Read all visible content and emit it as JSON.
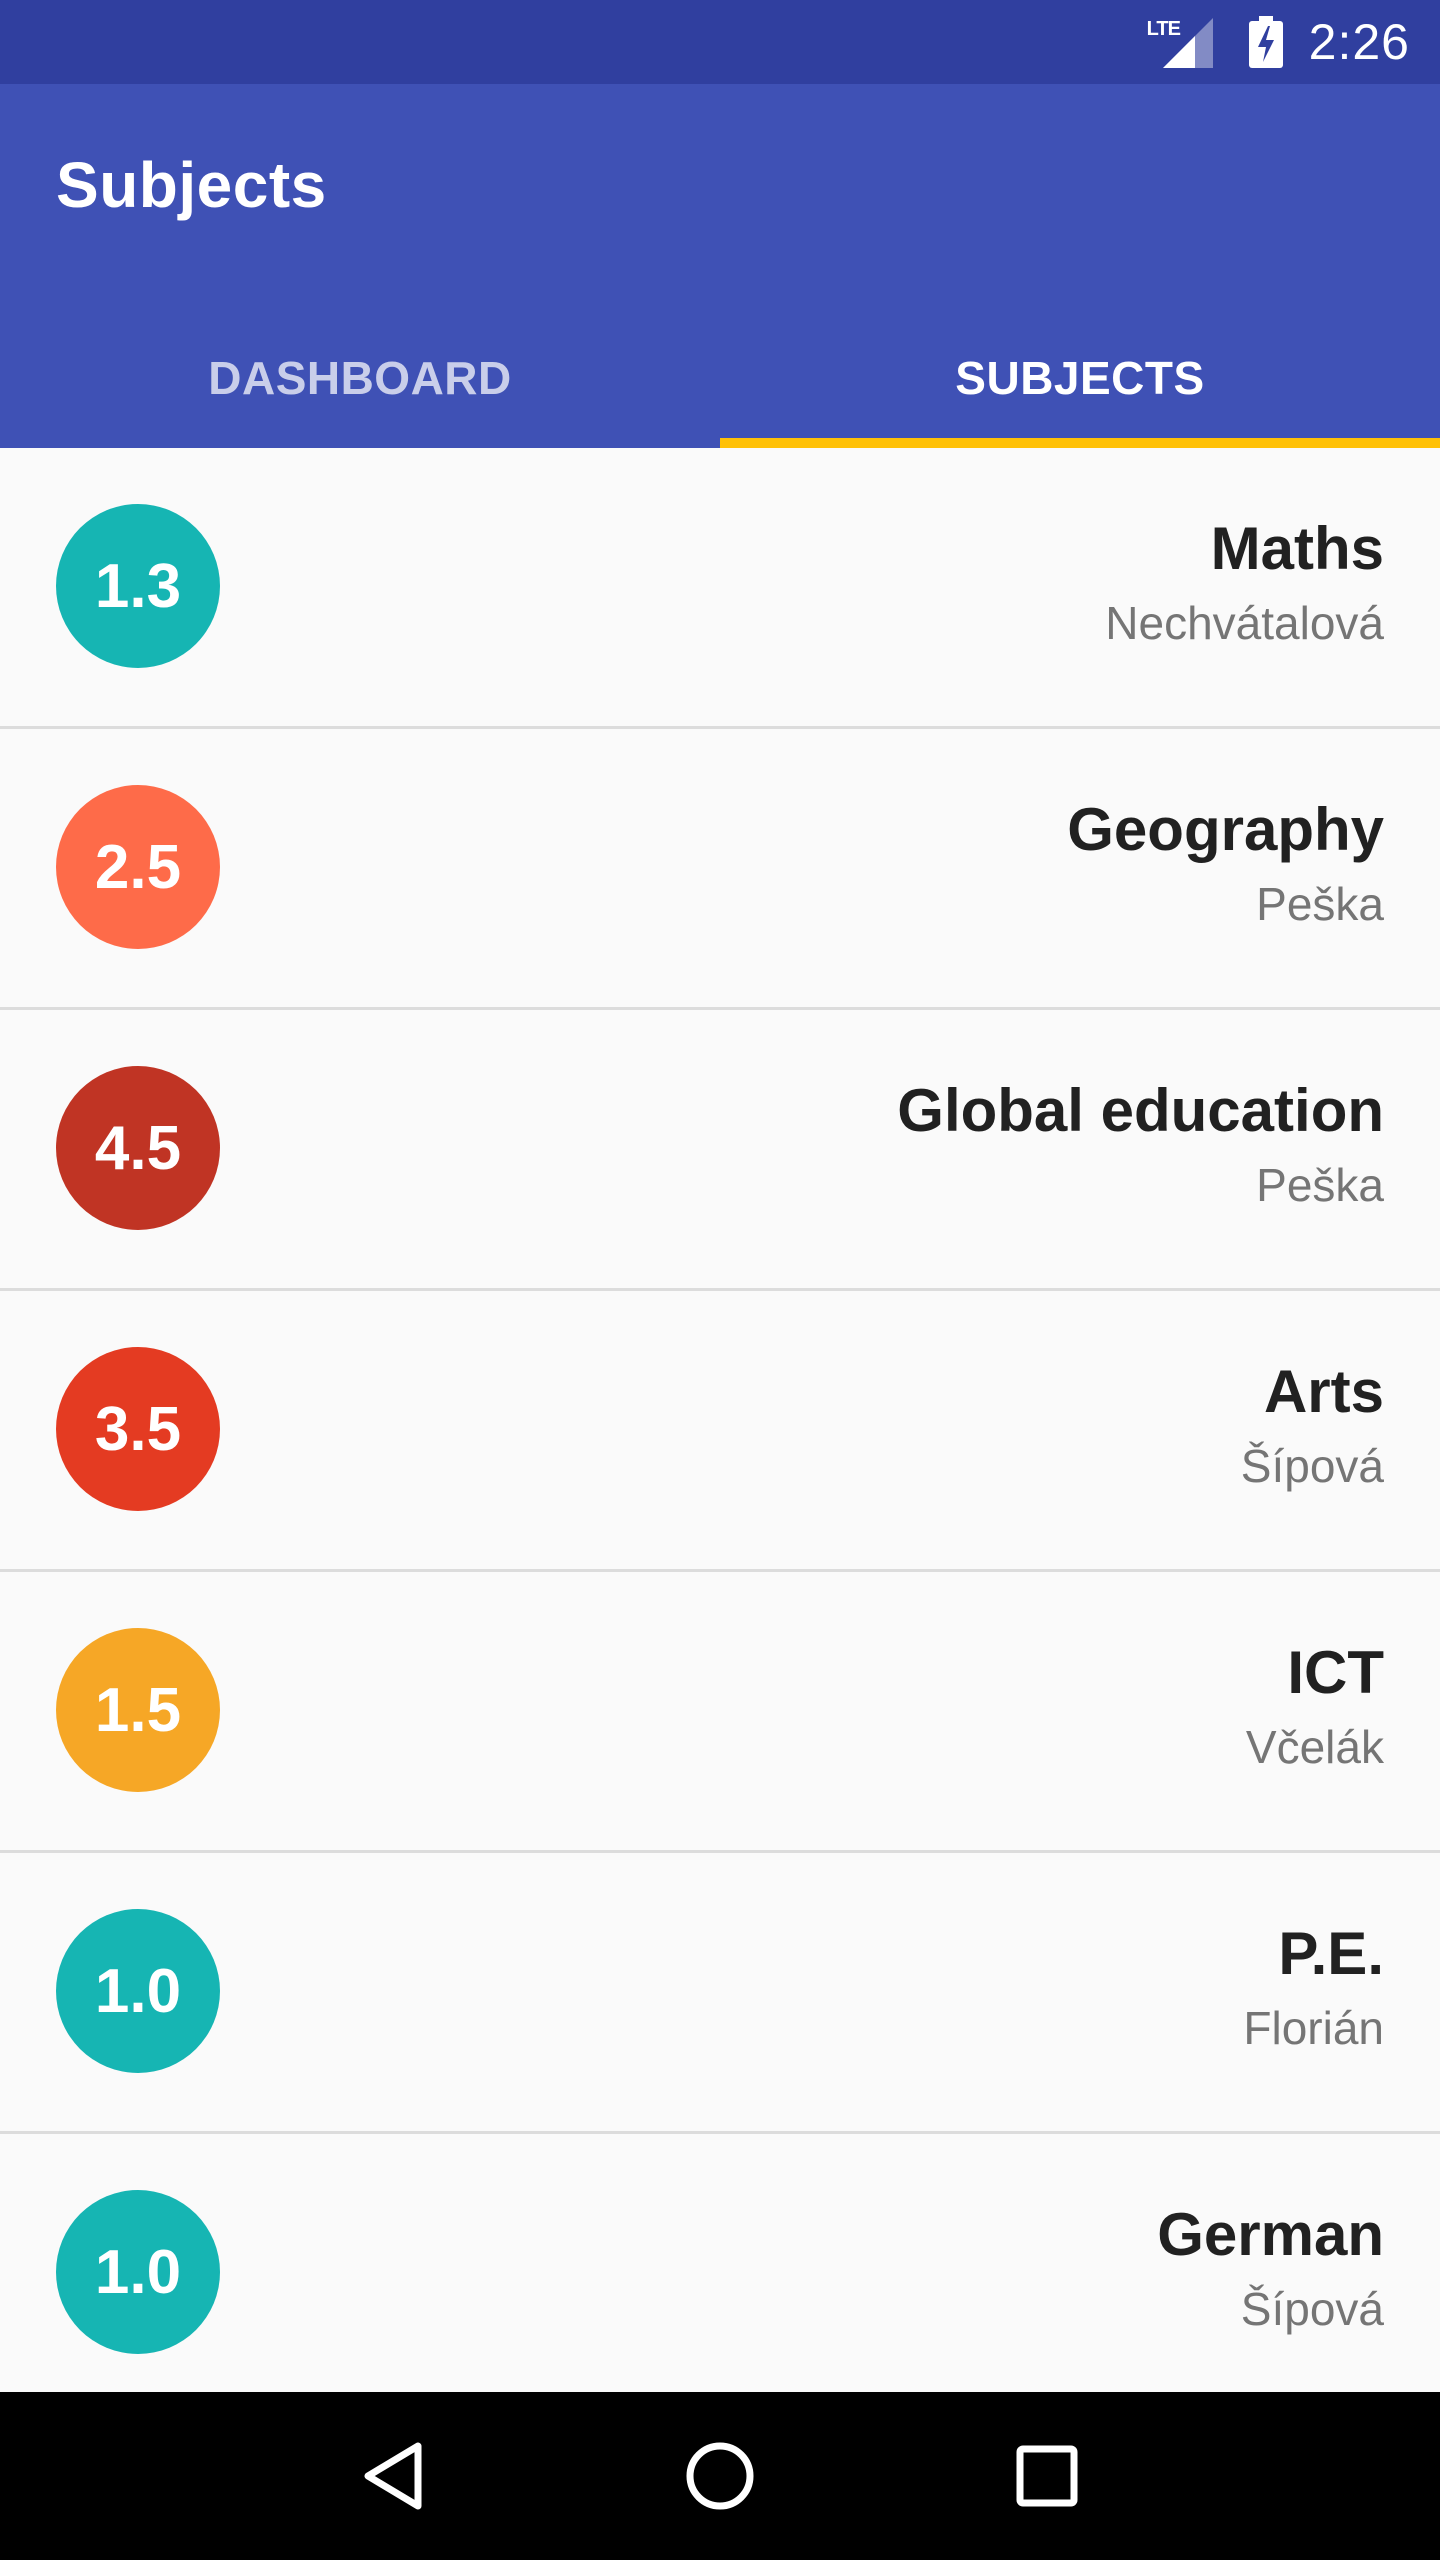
{
  "status_bar": {
    "network": "LTE",
    "time": "2:26"
  },
  "app_bar": {
    "title": "Subjects"
  },
  "tabs": [
    {
      "label": "DASHBOARD",
      "active": false
    },
    {
      "label": "SUBJECTS",
      "active": true
    }
  ],
  "colors": {
    "status_bar": "#303f9f",
    "primary": "#3f51b5",
    "tab_indicator": "#ffc107"
  },
  "subjects": [
    {
      "grade": "1.3",
      "name": "Maths",
      "teacher": "Nechvátalová",
      "color": "#16b5b3"
    },
    {
      "grade": "2.5",
      "name": "Geography",
      "teacher": "Peška",
      "color": "#fe6b49"
    },
    {
      "grade": "4.5",
      "name": "Global education",
      "teacher": "Peška",
      "color": "#c03424"
    },
    {
      "grade": "3.5",
      "name": "Arts",
      "teacher": "Šípová",
      "color": "#e43b22"
    },
    {
      "grade": "1.5",
      "name": "ICT",
      "teacher": "Včelák",
      "color": "#f6a726"
    },
    {
      "grade": "1.0",
      "name": "P.E.",
      "teacher": "Florián",
      "color": "#16b5b3"
    },
    {
      "grade": "1.0",
      "name": "German",
      "teacher": "Šípová",
      "color": "#16b5b3"
    }
  ],
  "nav_icons": [
    "back-icon",
    "home-icon",
    "recents-icon"
  ]
}
